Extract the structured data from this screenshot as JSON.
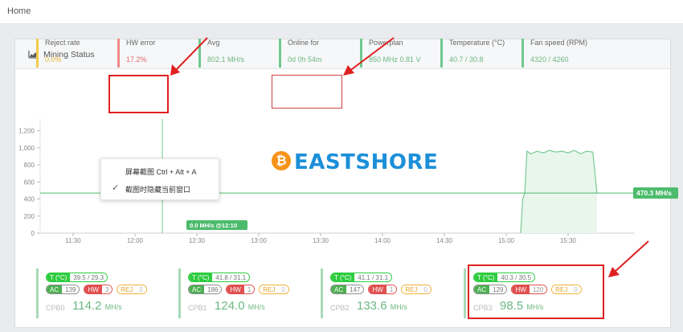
{
  "nav": {
    "home": "Home"
  },
  "panel": {
    "title": "Mining Status",
    "icon": "area-chart-icon"
  },
  "stats": [
    {
      "label": "Reject rate",
      "value": "0.0%",
      "color": "yellow"
    },
    {
      "label": "HW error",
      "value": "17.2%",
      "color": "red"
    },
    {
      "label": "Avg",
      "value": "802.1 MH/s",
      "color": "green"
    },
    {
      "label": "Online for",
      "value": "0d 0h 54m",
      "color": "green"
    },
    {
      "label": "Powerplan",
      "value": "850 MHz 0.81 V",
      "color": "green"
    },
    {
      "label": "Temperature (°C)",
      "value": "40.7 / 30.8",
      "color": "green"
    },
    {
      "label": "Fan speed (RPM)",
      "value": "4320 / 4260",
      "color": "green"
    }
  ],
  "chart_data": {
    "type": "area",
    "y_ticks": [
      "0",
      "200",
      "400",
      "600",
      "800",
      "1,000",
      "1,200"
    ],
    "ylim": [
      0,
      1300
    ],
    "x_ticks": [
      "11:30",
      "12:00",
      "12:30",
      "13:00",
      "13:30",
      "14:00",
      "14:30",
      "15:00",
      "15:30"
    ],
    "series": [
      {
        "x": [
          "15:07",
          "15:08",
          "15:09",
          "15:10",
          "15:12",
          "15:15",
          "15:18",
          "15:21",
          "15:24",
          "15:27",
          "15:30",
          "15:33",
          "15:36",
          "15:39",
          "15:42",
          "15:44"
        ],
        "values": [
          0,
          400,
          470,
          960,
          930,
          960,
          940,
          970,
          950,
          960,
          940,
          970,
          930,
          960,
          950,
          470
        ]
      }
    ],
    "reference_line": {
      "value": 470.3,
      "label": "470.3 MH/s"
    },
    "crosshair": {
      "label": "0.0 MH/s @12:10"
    },
    "fill_color": "#e8f6ec",
    "line_color": "#7acb92"
  },
  "context_menu": {
    "items": [
      "屏幕截图 Ctrl + Alt + A",
      "截图时隐藏当前窗口"
    ]
  },
  "brand": {
    "coin_symbol": "₿",
    "name": "EASTSHORE"
  },
  "boards": [
    {
      "temp_key": "T (°C)",
      "temp": "39.5 / 29.3",
      "ac": "139",
      "hw": "3",
      "rej": "0",
      "name": "CPB0",
      "rate": "114.2",
      "unit": "MH/s"
    },
    {
      "temp_key": "T (°C)",
      "temp": "41.8 / 31.1",
      "ac": "186",
      "hw": "1",
      "rej": "0",
      "name": "CPB1",
      "rate": "124.0",
      "unit": "MH/s"
    },
    {
      "temp_key": "T (°C)",
      "temp": "41.1 / 31.1",
      "ac": "147",
      "hw": "1",
      "rej": "0",
      "name": "CPB2",
      "rate": "133.6",
      "unit": "MH/s"
    },
    {
      "temp_key": "T (°C)",
      "temp": "40.3 / 30.5",
      "ac": "129",
      "hw": "120",
      "rej": "0",
      "name": "CPB3",
      "rate": "98.5",
      "unit": "MH/s"
    }
  ],
  "labels": {
    "ac": "AC",
    "hw": "HW",
    "rej": "REJ"
  }
}
